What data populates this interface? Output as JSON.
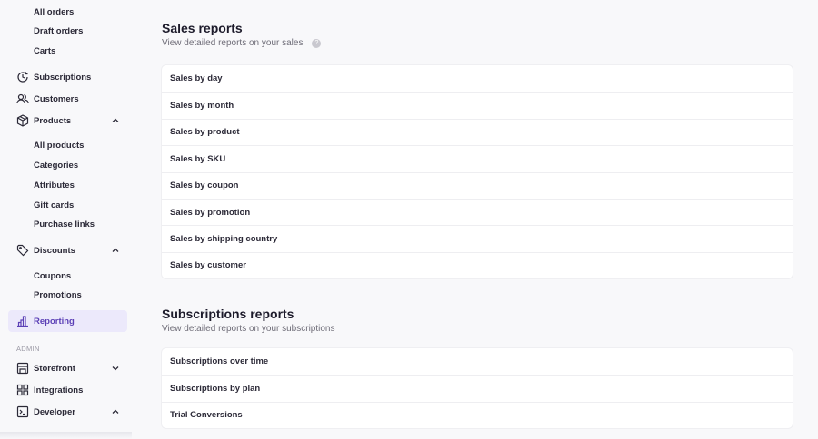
{
  "sidebar": {
    "orders_sub": [
      "All orders",
      "Draft orders",
      "Carts"
    ],
    "subscriptions": "Subscriptions",
    "customers": "Customers",
    "products": "Products",
    "products_sub": [
      "All products",
      "Categories",
      "Attributes",
      "Gift cards",
      "Purchase links"
    ],
    "discounts": "Discounts",
    "discounts_sub": [
      "Coupons",
      "Promotions"
    ],
    "reporting": "Reporting",
    "admin_label": "ADMIN",
    "storefront": "Storefront",
    "integrations": "Integrations",
    "developer": "Developer"
  },
  "sales": {
    "title": "Sales reports",
    "description": "View detailed reports on your sales",
    "help_icon": "?",
    "items": [
      "Sales by day",
      "Sales by month",
      "Sales by product",
      "Sales by SKU",
      "Sales by coupon",
      "Sales by promotion",
      "Sales by shipping country",
      "Sales by customer"
    ]
  },
  "subscriptions": {
    "title": "Subscriptions reports",
    "description": "View detailed reports on your subscriptions",
    "items": [
      "Subscriptions over time",
      "Subscriptions by plan",
      "Trial Conversions"
    ]
  },
  "colors": {
    "accent": "#5b3fb6",
    "active_bg": "#ece9fb"
  }
}
